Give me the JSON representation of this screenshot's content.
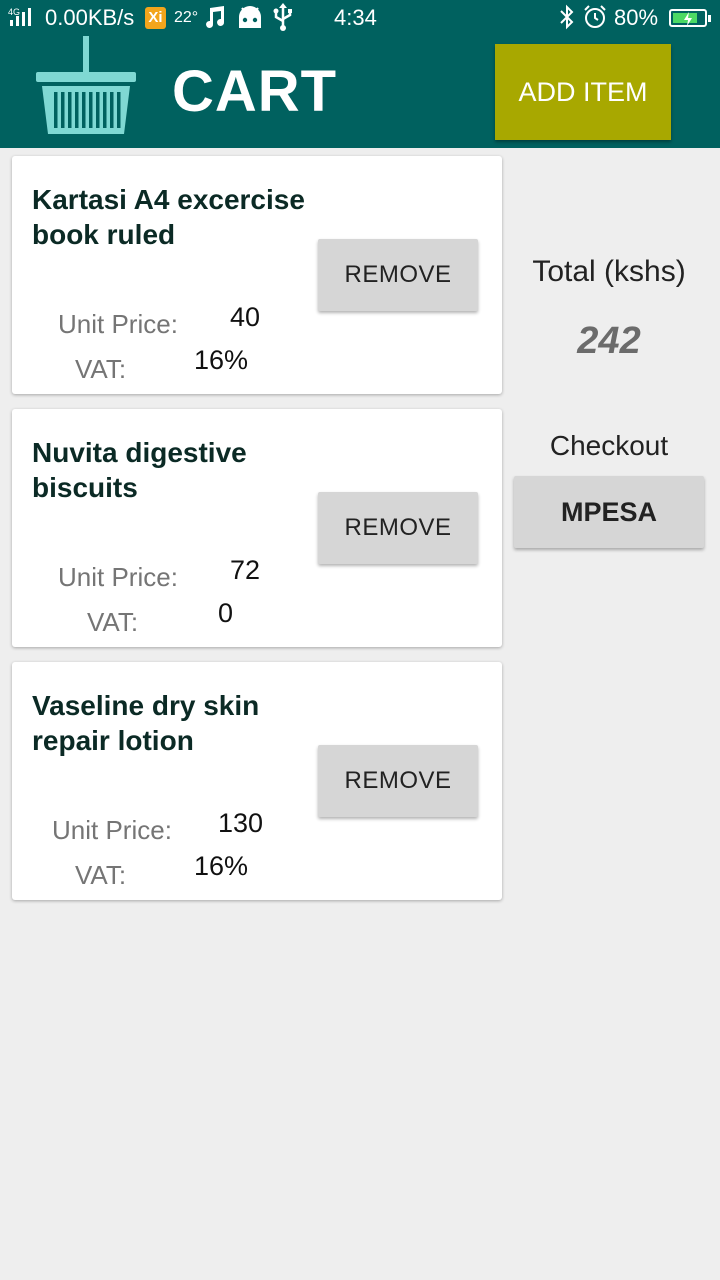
{
  "status_bar": {
    "network": "4G",
    "speed": "0.00KB/s",
    "xi_badge": "Xi",
    "temperature": "22°",
    "time": "4:34",
    "battery": "80%",
    "battery_level": 0.8,
    "icons": [
      "signal-icon",
      "xi-app-icon",
      "music-icon",
      "android-icon",
      "usb-icon",
      "bluetooth-icon",
      "alarm-icon",
      "battery-charging-icon"
    ]
  },
  "app_bar": {
    "title": "CART",
    "add_button_label": "ADD ITEM",
    "logo_icon": "basket-icon"
  },
  "cart": {
    "items": [
      {
        "name": "Kartasi A4 excercise book ruled",
        "remove_label": "REMOVE",
        "unit_price_label": "Unit Price:",
        "unit_price": "40",
        "vat_label": "VAT:",
        "vat": "16%"
      },
      {
        "name": "Nuvita digestive biscuits",
        "remove_label": "REMOVE",
        "unit_price_label": "Unit Price:",
        "unit_price": "72",
        "vat_label": "VAT:",
        "vat": "0"
      },
      {
        "name": "Vaseline dry skin repair lotion",
        "remove_label": "REMOVE",
        "unit_price_label": "Unit Price:",
        "unit_price": "130",
        "vat_label": "VAT:",
        "vat": "16%"
      }
    ]
  },
  "summary": {
    "total_label": "Total (kshs)",
    "total_value": "242",
    "checkout_label": "Checkout",
    "mpesa_label": "MPESA"
  },
  "colors": {
    "primary": "#00615f",
    "accent_button": "#a8a800",
    "background": "#eeeeee",
    "button_gray": "#d6d6d6",
    "basket": "#7fd8d3"
  }
}
